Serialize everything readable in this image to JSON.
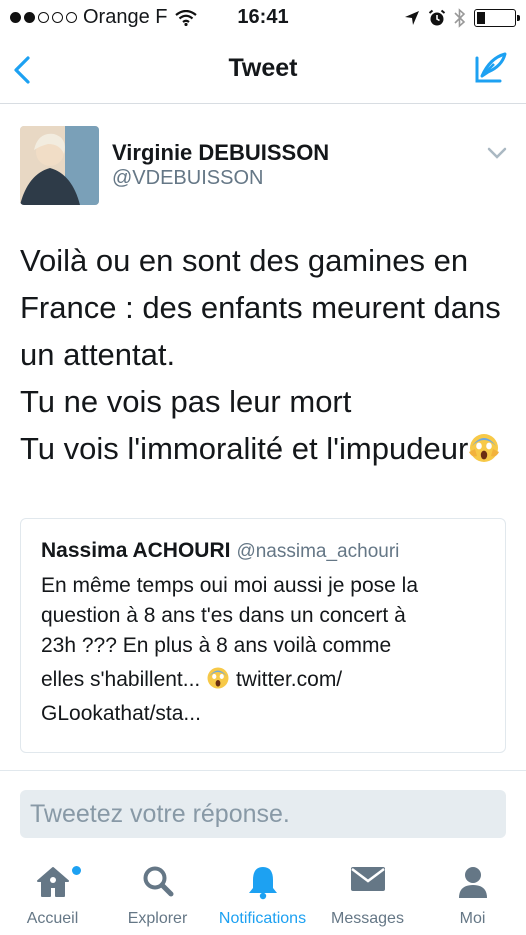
{
  "status_bar": {
    "carrier": "Orange F",
    "time": "16:41",
    "signal_bars_filled": 2,
    "signal_bars_total": 5,
    "battery_level": 0.22
  },
  "nav": {
    "title": "Tweet",
    "back_icon": "chevron-left-icon",
    "compose_icon": "compose-tweet-icon"
  },
  "tweet": {
    "author_name": "Virginie DEBUISSON",
    "author_handle": "@VDEBUISSON",
    "lines": [
      "Voilà ou en sont des gamines en",
      "France : des enfants meurent dans",
      "un attentat.",
      "Tu ne vois pas leur mort",
      "Tu vois l'immoralité et l'impudeur"
    ],
    "emoji": "screaming-face-icon"
  },
  "quoted_tweet": {
    "author_name": "Nassima ACHOURI",
    "author_handle": "@nassima_achouri",
    "lines": [
      "En même temps oui moi aussi je pose la",
      "question à 8 ans t'es dans un concert à",
      "23h ??? En plus à 8 ans voilà comme",
      "elles s'habillent...",
      "twitter.com/",
      "GLookathat/sta..."
    ]
  },
  "reply": {
    "placeholder": "Tweetez votre réponse."
  },
  "tab_bar": {
    "items": [
      {
        "label": "Accueil",
        "icon": "home-icon",
        "active": false,
        "badge": true
      },
      {
        "label": "Explorer",
        "icon": "search-icon",
        "active": false
      },
      {
        "label": "Notifications",
        "icon": "bell-icon",
        "active": true
      },
      {
        "label": "Messages",
        "icon": "envelope-icon",
        "active": false
      },
      {
        "label": "Moi",
        "icon": "profile-icon",
        "active": false
      }
    ]
  },
  "colors": {
    "accent": "#1da1f2",
    "text": "#14171a",
    "secondary": "#657786",
    "reply_bg": "#e6ecf0"
  }
}
